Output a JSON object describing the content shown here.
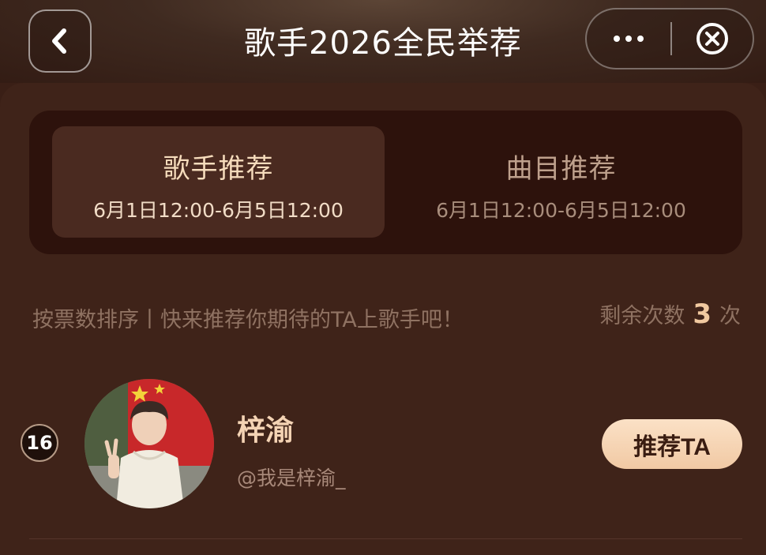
{
  "nav": {
    "title": "歌手2026全民举荐"
  },
  "tabs": [
    {
      "label": "歌手推荐",
      "time": "6月1日12:00-6月5日12:00",
      "active": true
    },
    {
      "label": "曲目推荐",
      "time": "6月1日12:00-6月5日12:00",
      "active": false
    }
  ],
  "info": {
    "hint": "按票数排序丨快来推荐你期待的TA上歌手吧！",
    "remaining_prefix": "剩余次数",
    "remaining_count": "3",
    "remaining_suffix": "次"
  },
  "singer": {
    "rank": "16",
    "name": "梓渝",
    "handle": "@我是梓渝_",
    "button_label": "推荐TA"
  },
  "colors": {
    "accent": "#f1c9a0",
    "background": "#3f2319",
    "tab_box": "#2d120c"
  },
  "icons": {
    "back": "chevron-left-icon",
    "more": "more-dots-icon",
    "close": "close-circle-icon"
  }
}
